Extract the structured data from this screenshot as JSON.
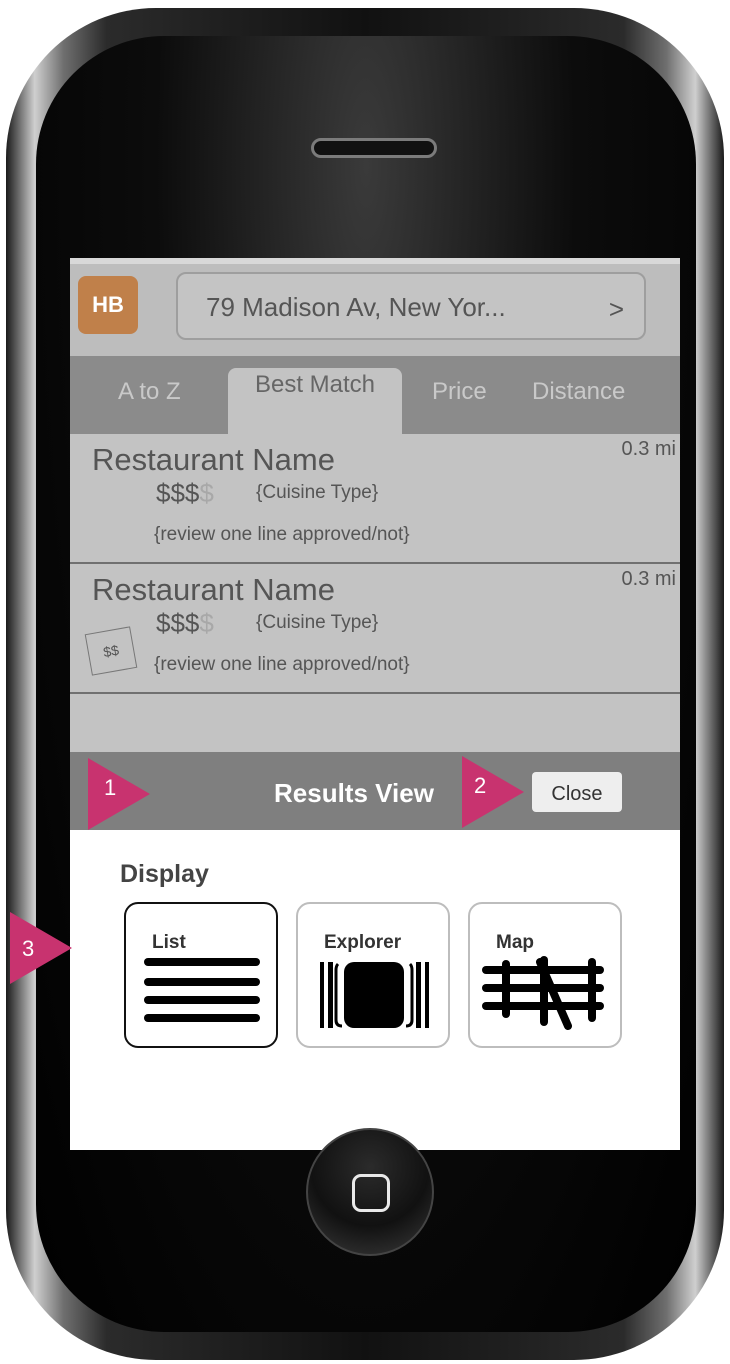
{
  "address": {
    "text": "79 Madison Av, New Yor...",
    "chevron": ">"
  },
  "logo": {
    "text": "HB"
  },
  "tabs": [
    {
      "label": "A to Z"
    },
    {
      "label": "Best Match",
      "active": true
    },
    {
      "label": "Price"
    },
    {
      "label": "Distance"
    }
  ],
  "results": [
    {
      "name": "Restaurant Name",
      "distance": "0.3 mi",
      "price_filled": "$$$",
      "price_empty": "$",
      "cuisine": "{Cuisine Type}",
      "review": "{review one line approved/not}"
    },
    {
      "name": "Restaurant Name",
      "distance": "0.3 mi",
      "price_filled": "$$$",
      "price_empty": "$",
      "cuisine": "{Cuisine Type}",
      "review": "{review one line approved/not}",
      "deal_badge": "$$"
    }
  ],
  "results_view": {
    "title": "Results View",
    "close_label": "Close",
    "display_label": "Display",
    "options": [
      {
        "label": "List",
        "icon": "list-icon",
        "selected": true
      },
      {
        "label": "Explorer",
        "icon": "explorer-icon",
        "selected": false
      },
      {
        "label": "Map",
        "icon": "map-icon",
        "selected": false
      }
    ]
  },
  "annotations": [
    "1",
    "2",
    "3"
  ],
  "colors": {
    "logo_bg": "#c0804a",
    "annotation": "#c8336f",
    "tab_bar": "#8b8b8b",
    "results_header": "#7f7f7f"
  }
}
